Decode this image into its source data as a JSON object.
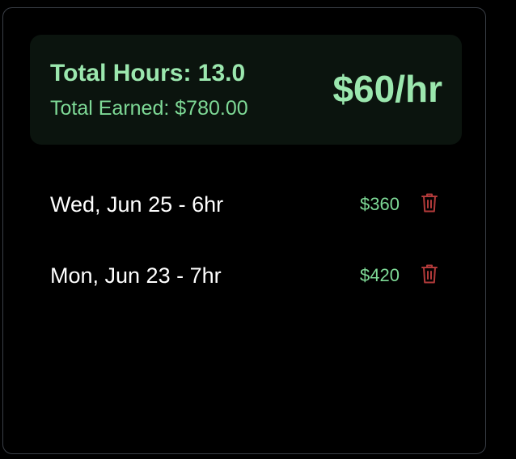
{
  "summary": {
    "total_hours": "Total Hours: 13.0",
    "total_earned": "Total Earned: $780.00",
    "rate": "$60/hr"
  },
  "entries": [
    {
      "label": "Wed, Jun 25 - 6hr",
      "amount": "$360",
      "delete_icon": "trash-icon"
    },
    {
      "label": "Mon, Jun 23 - 7hr",
      "amount": "$420",
      "delete_icon": "trash-icon"
    }
  ],
  "colors": {
    "accent_green": "#9be7ae",
    "delete_red": "#b23a3a",
    "summary_bg": "#0b140e",
    "card_border": "#3a3f47"
  }
}
